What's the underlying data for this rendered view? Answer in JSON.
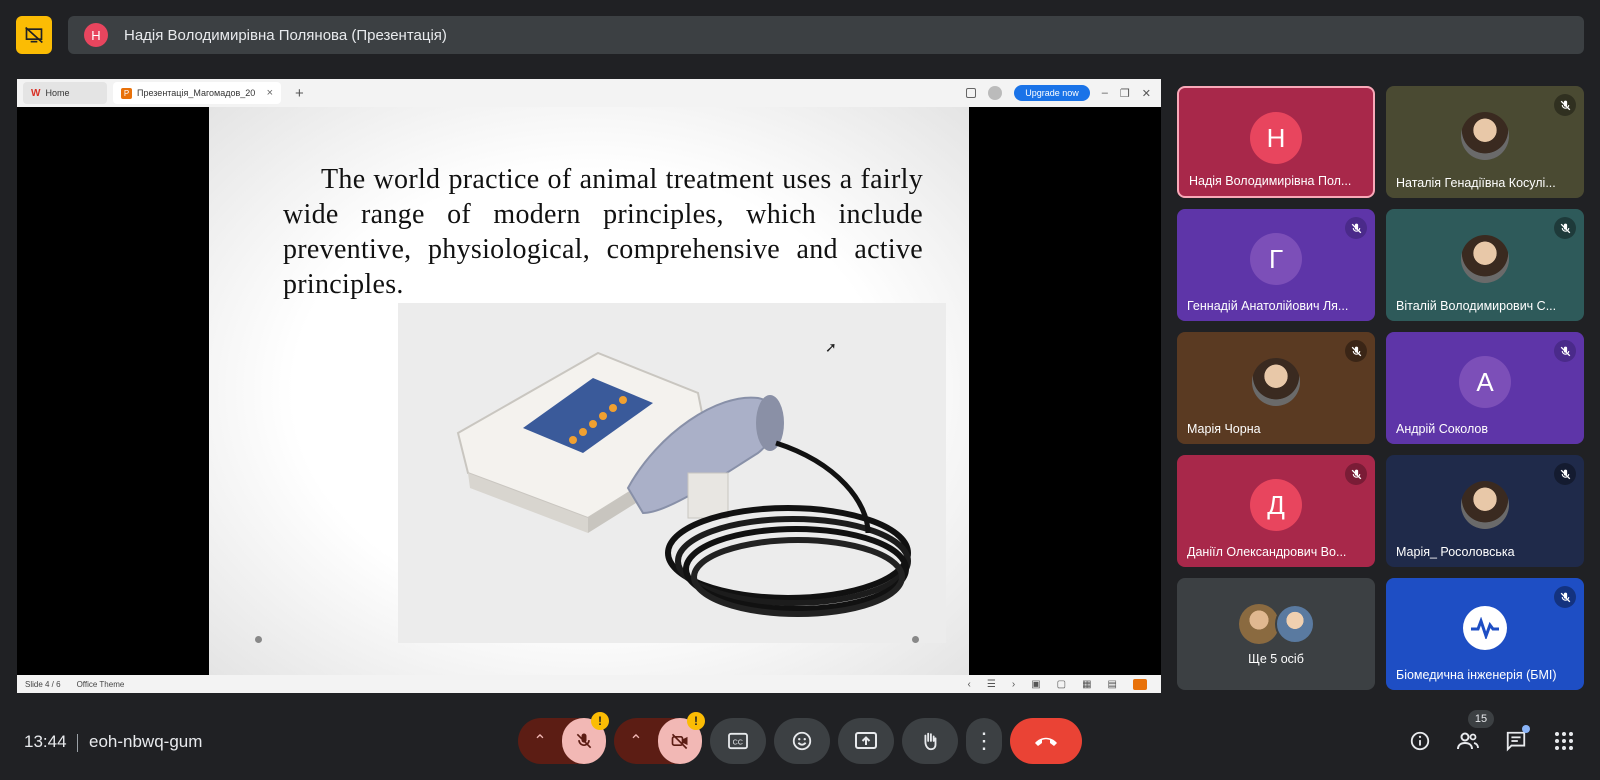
{
  "presenter_banner": {
    "avatar_letter": "Н",
    "text": "Надія Володимирівна Полянова (Презентація)"
  },
  "shared_window": {
    "tabs": [
      {
        "label": "Home"
      },
      {
        "label": "Презентація_Магомадов_20"
      }
    ],
    "upgrade_label": "Upgrade now",
    "slide_text": "The world practice of animal treatment uses a fairly wide range of modern principles, which include preventive, physiological, comprehensive and active principles.",
    "status_slide": "Slide 4 / 6",
    "status_theme": "Office Theme"
  },
  "participants": [
    {
      "name": "Надія Володимирівна Пол...",
      "avatar": "Н",
      "avatar_color": "#e8455e",
      "bg": "#a8284a",
      "muted": false,
      "speaking": true,
      "type": "letter"
    },
    {
      "name": "Наталія Генадіївна Косулі...",
      "avatar": "",
      "bg": "#4a4a32",
      "muted": true,
      "type": "photo"
    },
    {
      "name": "Геннадій Анатолійович Ля...",
      "avatar": "Г",
      "avatar_color": "#7c4fb8",
      "bg": "#5e35a8",
      "muted": true,
      "type": "letter"
    },
    {
      "name": "Віталій Володимирович С...",
      "avatar": "",
      "bg": "#2e5a5a",
      "muted": true,
      "type": "photo"
    },
    {
      "name": "Марія Чорна",
      "avatar": "",
      "bg": "#5a3a22",
      "muted": true,
      "type": "photo"
    },
    {
      "name": "Андрій Соколов",
      "avatar": "А",
      "avatar_color": "#7c4fb8",
      "bg": "#5e35a8",
      "muted": true,
      "type": "letter"
    },
    {
      "name": "Даніїл Олександрович Во...",
      "avatar": "Д",
      "avatar_color": "#e8455e",
      "bg": "#a8284a",
      "muted": true,
      "type": "letter"
    },
    {
      "name": "Марія_ Росоловська",
      "avatar": "",
      "bg": "#1f2a4a",
      "muted": true,
      "type": "photo"
    },
    {
      "name": "Ще 5 осіб",
      "avatar": "",
      "bg": "#3c4043",
      "muted": false,
      "type": "more"
    },
    {
      "name": "Біомедична інженерія (БМІ)",
      "avatar": "",
      "bg": "#1e4ec4",
      "muted": true,
      "type": "logo"
    }
  ],
  "bottom_bar": {
    "time": "13:44",
    "meeting_code": "eoh-nbwq-gum",
    "participants_count": "15",
    "warning_mark": "!"
  },
  "colors": {
    "background": "#202124",
    "present_icon": "#fbbc04",
    "leave_button": "#ea4335",
    "mic_group": "#5c1d14"
  }
}
